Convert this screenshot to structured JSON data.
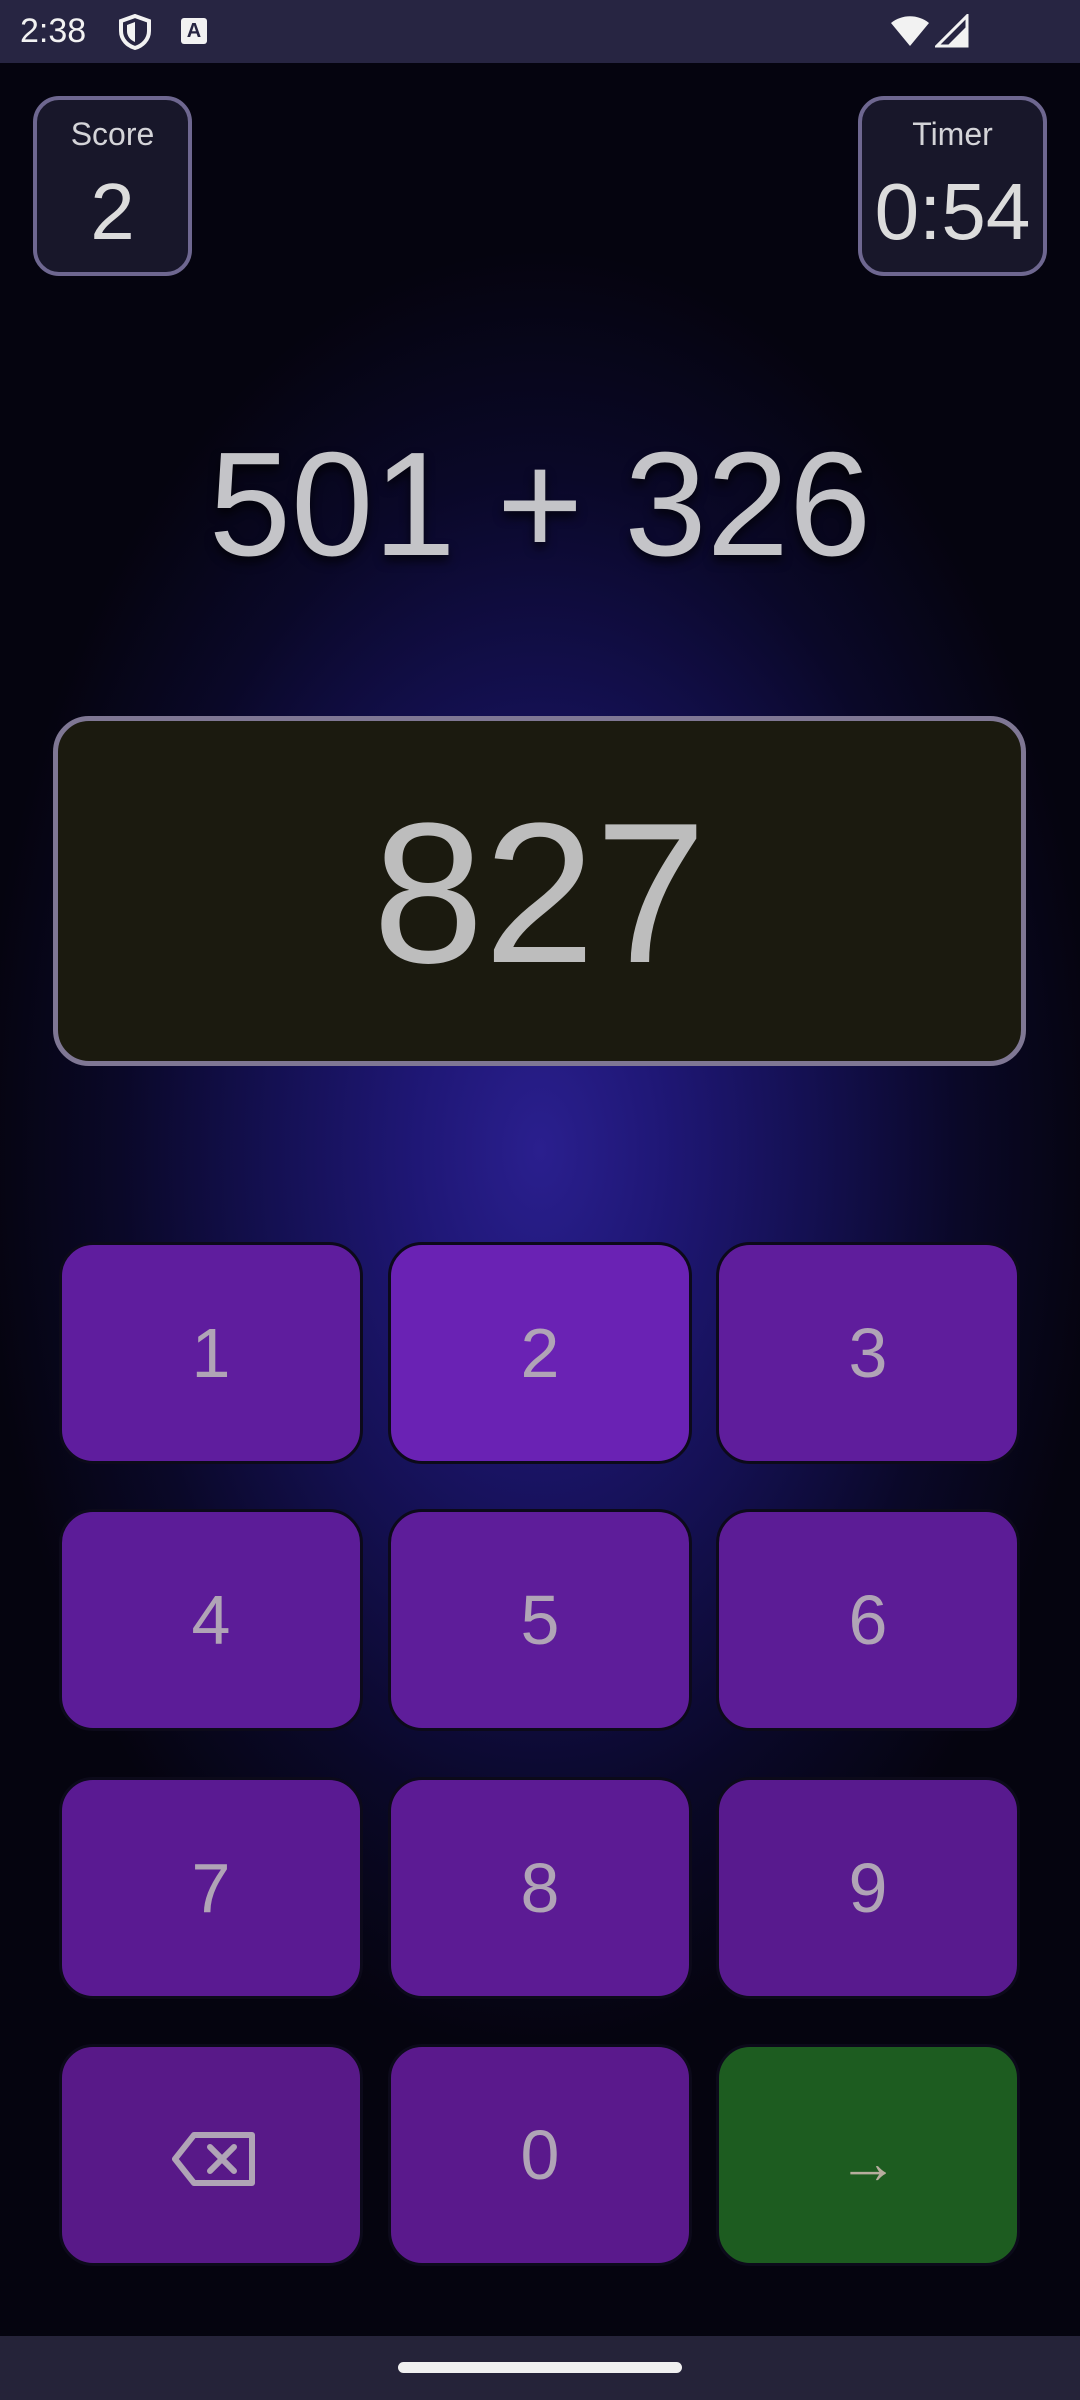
{
  "status_bar": {
    "time": "2:38",
    "icons": [
      "shield-icon",
      "a-badge-icon",
      "wifi-icon",
      "signal-icon"
    ],
    "a_badge": "A"
  },
  "score": {
    "label": "Score",
    "value": "2"
  },
  "timer": {
    "label": "Timer",
    "value": "0:54"
  },
  "equation": "501 + 326",
  "answer": "827",
  "keypad": {
    "keys": [
      "1",
      "2",
      "3",
      "4",
      "5",
      "6",
      "7",
      "8",
      "9",
      "0"
    ],
    "backspace_icon": "backspace-icon",
    "enter_label": "→"
  },
  "colors": {
    "key_purple": "#5f1d98",
    "enter_green": "#1d5c20",
    "answer_box_bg": "#1b1a0f",
    "background_glow": "#2a1f8e"
  }
}
